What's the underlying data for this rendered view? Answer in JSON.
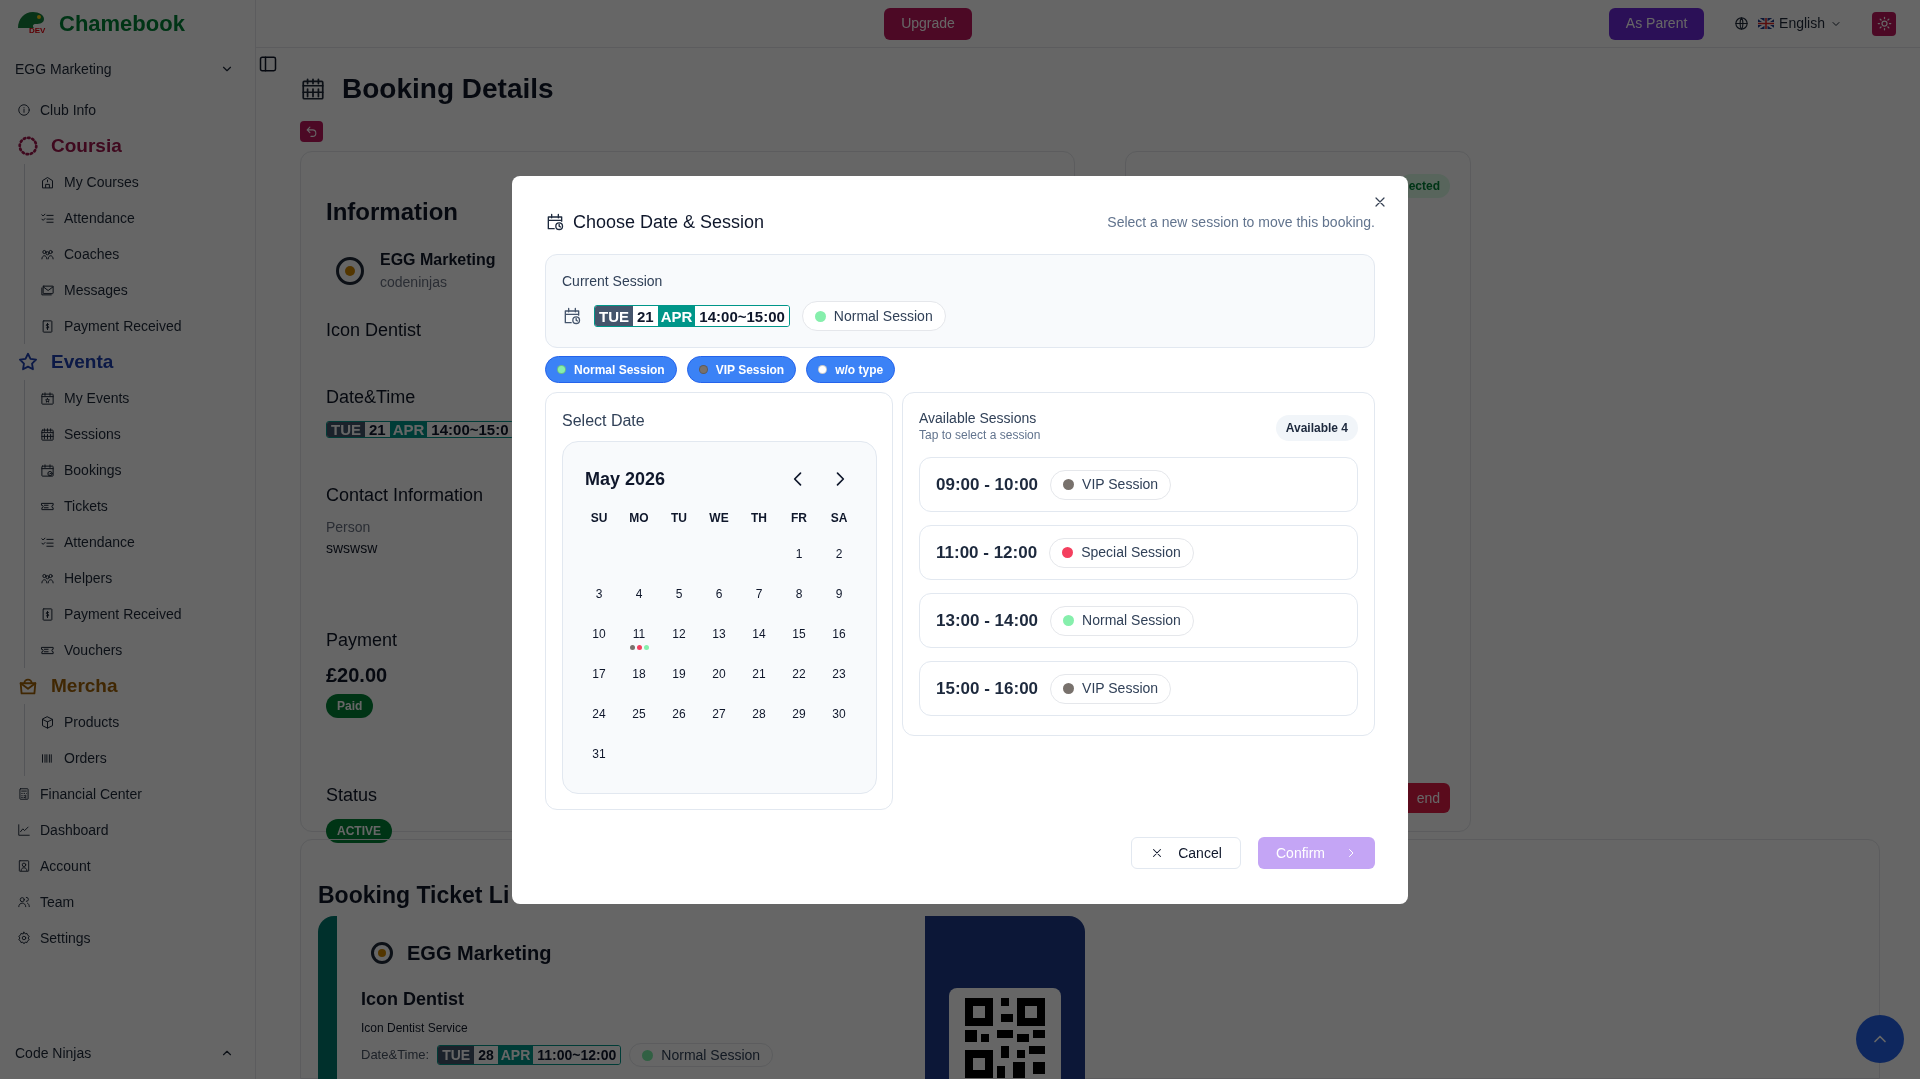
{
  "sidebar": {
    "brand": "Chamebook",
    "logo_tag": "DEV",
    "organization": "EGG Marketing",
    "items": [
      {
        "kind": "link",
        "label": "Club Info"
      },
      {
        "kind": "section",
        "label": "Coursia",
        "children": [
          {
            "label": "My Courses"
          },
          {
            "label": "Attendance"
          },
          {
            "label": "Coaches"
          },
          {
            "label": "Messages"
          },
          {
            "label": "Payment Received"
          }
        ]
      },
      {
        "kind": "section",
        "label": "Eventa",
        "children": [
          {
            "label": "My Events"
          },
          {
            "label": "Sessions"
          },
          {
            "label": "Bookings"
          },
          {
            "label": "Tickets"
          },
          {
            "label": "Attendance"
          },
          {
            "label": "Helpers"
          },
          {
            "label": "Payment Received"
          },
          {
            "label": "Vouchers"
          }
        ]
      },
      {
        "kind": "section",
        "label": "Mercha",
        "children": [
          {
            "label": "Products"
          },
          {
            "label": "Orders"
          }
        ]
      },
      {
        "kind": "link",
        "label": "Financial Center"
      },
      {
        "kind": "link",
        "label": "Dashboard"
      },
      {
        "kind": "link",
        "label": "Account"
      },
      {
        "kind": "link",
        "label": "Team"
      },
      {
        "kind": "link",
        "label": "Settings"
      }
    ],
    "footer": "Code Ninjas"
  },
  "top_bar": {
    "upgrade": "Upgrade",
    "role_button": "As Parent",
    "language": "English"
  },
  "page": {
    "title": "Booking Details",
    "information": {
      "heading": "Information",
      "club_name": "EGG Marketing",
      "club_handle": "codeninjas",
      "service": "Icon Dentist",
      "datetime_label": "Date&Time",
      "datetime": {
        "weekday": "TUE",
        "day": "21",
        "month": "APR",
        "time": "14:00~15:0"
      },
      "contact_label": "Contact Information",
      "person_label": "Person",
      "person": "swswsw",
      "payment_label": "Payment",
      "amount": "£20.00",
      "payment_status": "Paid",
      "status_label": "Status",
      "status": "ACTIVE"
    },
    "side_card": {
      "badge": "ected",
      "button": "end"
    },
    "ticket_list": {
      "heading": "Booking Ticket Li",
      "ticket": {
        "club_name": "EGG Marketing",
        "service": "Icon Dentist",
        "service_detail": "Icon Dentist Service",
        "datetime_label": "Date&Time:",
        "datetime": {
          "weekday": "TUE",
          "day": "28",
          "month": "APR",
          "time": "11:00~12:00"
        },
        "session_type": {
          "label": "Normal Session"
        }
      }
    }
  },
  "dialog": {
    "title": "Choose Date & Session",
    "hint": "Select a new session to move this booking.",
    "current": {
      "label": "Current Session",
      "datetime": {
        "weekday": "TUE",
        "day": "21",
        "month": "APR",
        "time": "14:00~15:00"
      },
      "session_type": {
        "label": "Normal Session",
        "color": "#86efac"
      }
    },
    "filters": [
      {
        "label": "Normal Session",
        "color": "#86efac",
        "selected": true
      },
      {
        "label": "VIP Session",
        "color": "#78716c",
        "selected": true
      },
      {
        "label": "w/o type",
        "color": "#ffffff",
        "selected": true
      }
    ],
    "calendar": {
      "heading": "Select Date",
      "month": "May 2026",
      "weekdays": [
        "SU",
        "MO",
        "TU",
        "WE",
        "TH",
        "FR",
        "SA"
      ],
      "cells": [
        {
          "kind": "blank"
        },
        {
          "kind": "blank"
        },
        {
          "kind": "blank"
        },
        {
          "kind": "blank"
        },
        {
          "kind": "blank"
        },
        {
          "kind": "day",
          "day": "1"
        },
        {
          "kind": "day",
          "day": "2"
        },
        {
          "kind": "day",
          "day": "3"
        },
        {
          "kind": "day",
          "day": "4"
        },
        {
          "kind": "day",
          "day": "5"
        },
        {
          "kind": "day",
          "day": "6"
        },
        {
          "kind": "day",
          "day": "7"
        },
        {
          "kind": "day",
          "day": "8"
        },
        {
          "kind": "day",
          "day": "9"
        },
        {
          "kind": "day",
          "day": "10"
        },
        {
          "kind": "day",
          "day": "11",
          "dots": [
            {
              "color": "#78716c"
            },
            {
              "color": "#f43f5e"
            },
            {
              "color": "#86efac"
            }
          ]
        },
        {
          "kind": "day",
          "day": "12"
        },
        {
          "kind": "day",
          "day": "13"
        },
        {
          "kind": "day",
          "day": "14"
        },
        {
          "kind": "day",
          "day": "15"
        },
        {
          "kind": "day",
          "day": "16"
        },
        {
          "kind": "day",
          "day": "17"
        },
        {
          "kind": "day",
          "day": "18"
        },
        {
          "kind": "day",
          "day": "19"
        },
        {
          "kind": "day",
          "day": "20"
        },
        {
          "kind": "day",
          "day": "21"
        },
        {
          "kind": "day",
          "day": "22"
        },
        {
          "kind": "day",
          "day": "23"
        },
        {
          "kind": "day",
          "day": "24"
        },
        {
          "kind": "day",
          "day": "25"
        },
        {
          "kind": "day",
          "day": "26"
        },
        {
          "kind": "day",
          "day": "27"
        },
        {
          "kind": "day",
          "day": "28"
        },
        {
          "kind": "day",
          "day": "29"
        },
        {
          "kind": "day",
          "day": "30"
        },
        {
          "kind": "day",
          "day": "31"
        }
      ]
    },
    "sessions": {
      "heading": "Available Sessions",
      "subheading": "Tap to select a session",
      "count_badge": "Available 4",
      "items": [
        {
          "time": "09:00 - 10:00",
          "type": {
            "label": "VIP Session",
            "color": "#78716c"
          },
          "selected": false
        },
        {
          "time": "11:00 - 12:00",
          "type": {
            "label": "Special Session",
            "color": "#f43f5e"
          },
          "selected": false
        },
        {
          "time": "13:00 - 14:00",
          "type": {
            "label": "Normal Session",
            "color": "#86efac"
          },
          "selected": false
        },
        {
          "time": "15:00 - 16:00",
          "type": {
            "label": "VIP Session",
            "color": "#78716c"
          },
          "selected": false
        }
      ]
    },
    "cancel": "Cancel",
    "confirm": {
      "label": "Confirm",
      "disabled": true
    }
  }
}
